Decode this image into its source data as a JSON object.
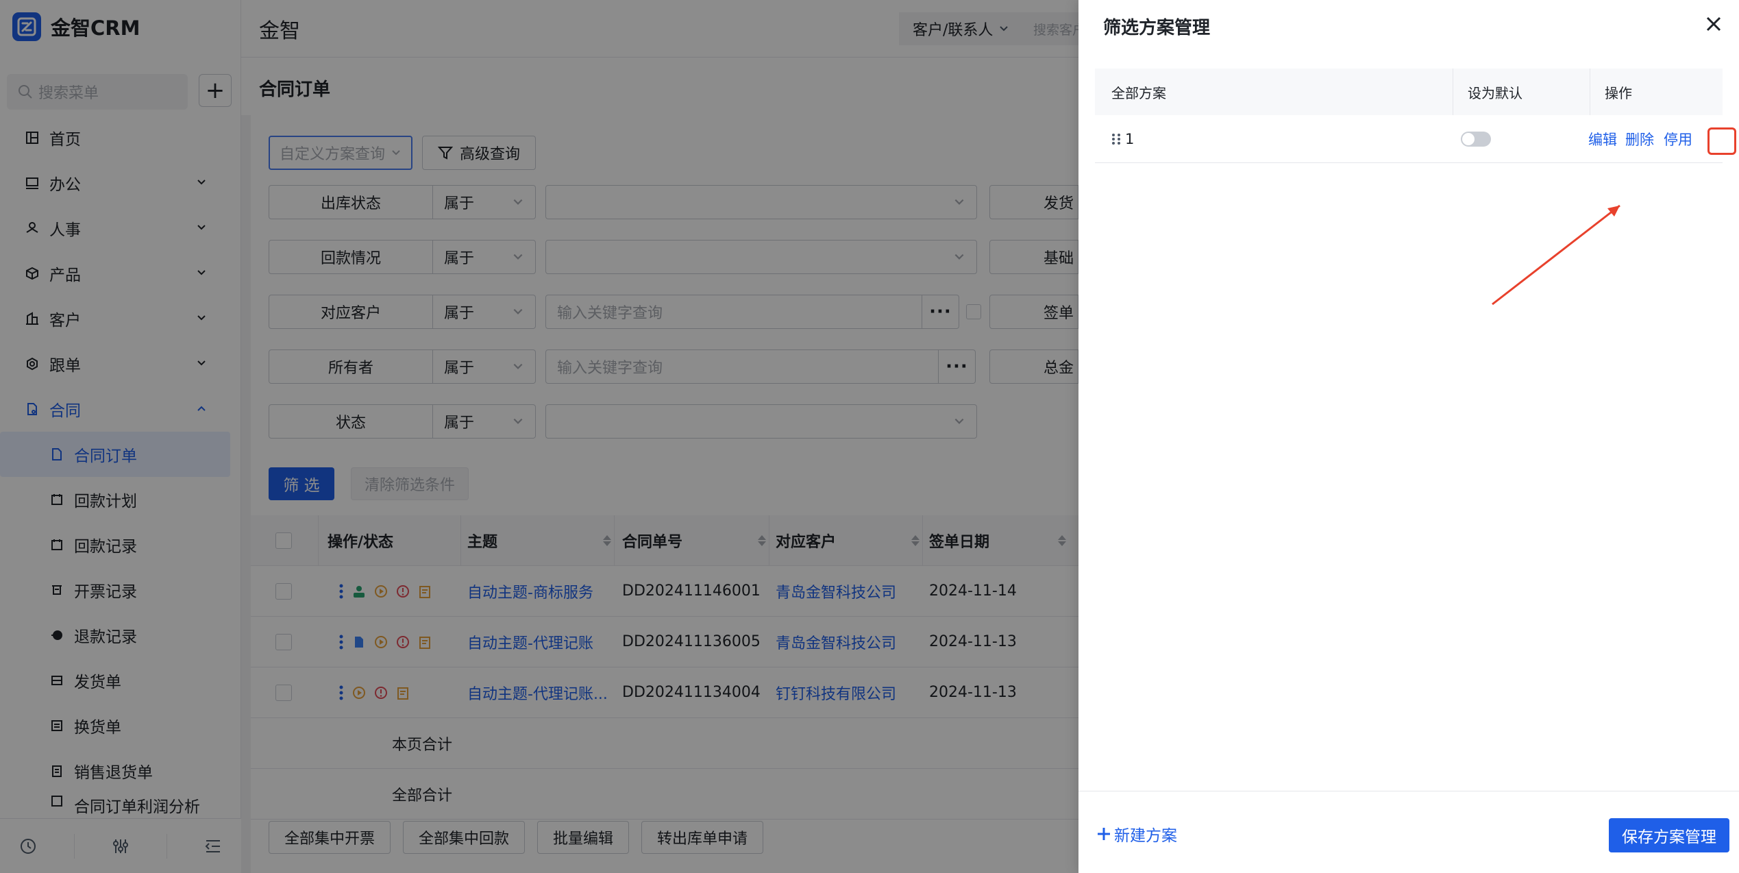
{
  "app": {
    "logo_text": "金智CRM",
    "brand_color": "#1f5fe8"
  },
  "topbar": {
    "title": "金智",
    "select_label": "客户/联系人",
    "search_placeholder": "搜索客户"
  },
  "sidebar": {
    "search_placeholder": "搜索菜单",
    "add_label": "+",
    "items": [
      {
        "label": "首页",
        "icon": "home-icon"
      },
      {
        "label": "办公",
        "icon": "office-icon"
      },
      {
        "label": "人事",
        "icon": "hr-icon"
      },
      {
        "label": "产品",
        "icon": "product-icon"
      },
      {
        "label": "客户",
        "icon": "customer-icon"
      },
      {
        "label": "跟单",
        "icon": "follow-icon"
      },
      {
        "label": "合同",
        "icon": "contract-icon"
      }
    ],
    "sub_items": [
      {
        "label": "合同订单"
      },
      {
        "label": "回款计划"
      },
      {
        "label": "回款记录"
      },
      {
        "label": "开票记录"
      },
      {
        "label": "退款记录"
      },
      {
        "label": "发货单"
      },
      {
        "label": "换货单"
      },
      {
        "label": "销售退货单"
      },
      {
        "label": "合同订单利润分析"
      }
    ]
  },
  "page": {
    "title": "合同订单",
    "scheme_placeholder": "自定义方案查询",
    "advanced_label": "高级查询",
    "filters": [
      {
        "label": "出库状态",
        "op": "属于",
        "value": "",
        "right": "发货"
      },
      {
        "label": "回款情况",
        "op": "属于",
        "value": "",
        "right": "基础"
      },
      {
        "label": "对应客户",
        "op": "属于",
        "value": "输入关键字查询",
        "right": "签单"
      },
      {
        "label": "所有者",
        "op": "属于",
        "value": "输入关键字查询",
        "right": "总金"
      },
      {
        "label": "状态",
        "op": "属于",
        "value": ""
      }
    ],
    "dots_label": "···",
    "filter_button": "筛 选",
    "clear_button": "清除筛选条件",
    "table": {
      "headers": [
        "操作/状态",
        "主题",
        "合同单号",
        "对应客户",
        "签单日期"
      ],
      "rows": [
        {
          "subject": "自动主题-商标服务",
          "number": "DD202411146001",
          "customer": "青岛金智科技公司",
          "date": "2024-11-14"
        },
        {
          "subject": "自动主题-代理记账",
          "number": "DD202411136005",
          "customer": "青岛金智科技公司",
          "date": "2024-11-13"
        },
        {
          "subject": "自动主题-代理记账...",
          "number": "DD202411134004",
          "customer": "钉钉科技有限公司",
          "date": "2024-11-13"
        }
      ],
      "page_total": "本页合计",
      "all_total": "全部合计"
    },
    "bottom_actions": [
      "全部集中开票",
      "全部集中回款",
      "批量编辑",
      "转出库单申请"
    ]
  },
  "drawer": {
    "title": "筛选方案管理",
    "headers": [
      "全部方案",
      "设为默认",
      "操作"
    ],
    "rows": [
      {
        "name": "1",
        "default": false,
        "actions": [
          "编辑",
          "删除",
          "停用"
        ]
      }
    ],
    "new_scheme_label": "新建方案",
    "save_label": "保存方案管理",
    "annotation_color": "#e8412c"
  }
}
